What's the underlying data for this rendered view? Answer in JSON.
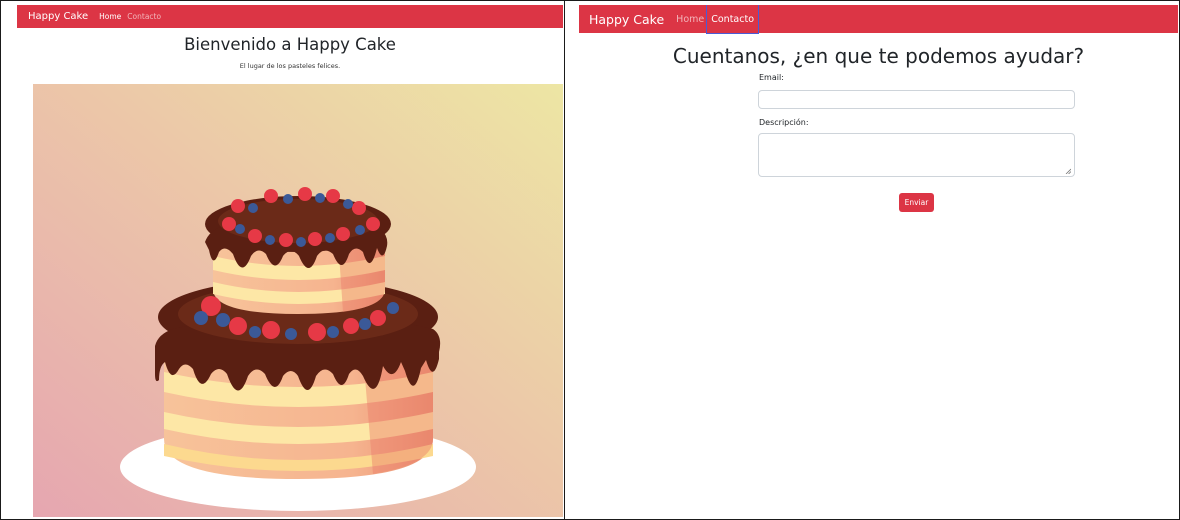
{
  "home": {
    "brand": "Happy Cake",
    "nav": {
      "home": "Home",
      "contact": "Contacto"
    },
    "title": "Bienvenido a Happy Cake",
    "subtitle": "El lugar de los pasteles felices."
  },
  "contact": {
    "brand": "Happy Cake",
    "nav": {
      "home": "Home",
      "contact": "Contacto"
    },
    "title": "Cuentanos, ¿en que te podemos ayudar?",
    "email_label": "Email:",
    "email_value": "",
    "description_label": "Descripción:",
    "description_value": "",
    "submit_label": "Enviar"
  },
  "colors": {
    "navbar": "#dc3545",
    "button": "#dc3545",
    "text": "#212529"
  }
}
